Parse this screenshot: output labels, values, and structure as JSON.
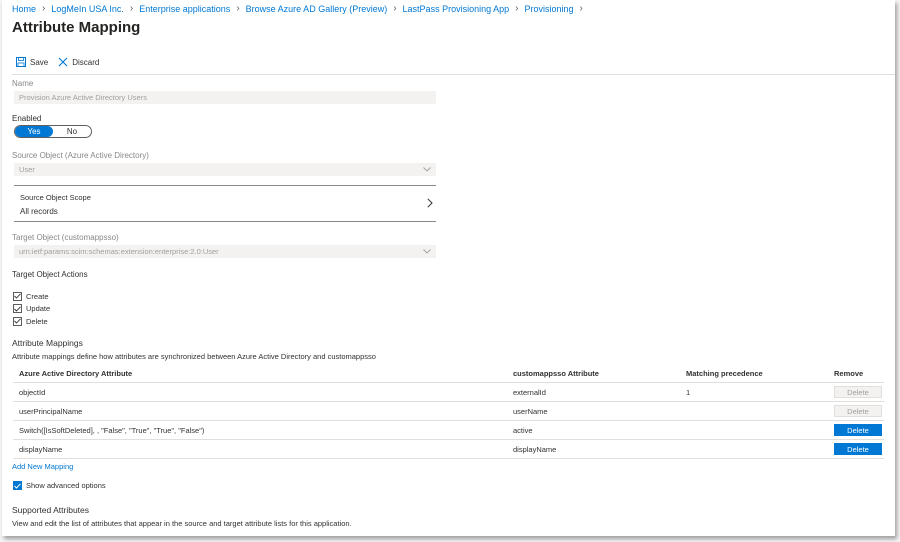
{
  "breadcrumb": [
    {
      "label": "Home"
    },
    {
      "label": "LogMeIn USA Inc."
    },
    {
      "label": "Enterprise applications"
    },
    {
      "label": "Browse Azure AD Gallery (Preview)"
    },
    {
      "label": "LastPass Provisioning App"
    },
    {
      "label": "Provisioning"
    }
  ],
  "page_title": "Attribute Mapping",
  "toolbar": {
    "save_label": "Save",
    "discard_label": "Discard"
  },
  "form": {
    "name_label": "Name",
    "name_value": "Provision Azure Active Directory Users",
    "enabled_label": "Enabled",
    "enabled_yes": "Yes",
    "enabled_no": "No",
    "source_object_label": "Source Object (Azure Active Directory)",
    "source_object_value": "User",
    "source_scope_label": "Source Object Scope",
    "source_scope_value": "All records",
    "target_object_label": "Target Object (customappsso)",
    "target_object_value": "urn:ietf:params:scim:schemas:extension:enterprise:2.0:User",
    "target_actions_label": "Target Object Actions",
    "target_actions": [
      {
        "label": "Create",
        "checked": true
      },
      {
        "label": "Update",
        "checked": true
      },
      {
        "label": "Delete",
        "checked": true
      }
    ]
  },
  "mappings": {
    "heading": "Attribute Mappings",
    "description": "Attribute mappings define how attributes are synchronized between Azure Active Directory and customappsso",
    "columns": [
      "Azure Active Directory Attribute",
      "customappsso Attribute",
      "Matching precedence",
      "Remove"
    ],
    "rows": [
      {
        "source": "objectId",
        "target": "externalId",
        "precedence": "1",
        "delete": "Delete",
        "delete_enabled": false
      },
      {
        "source": "userPrincipalName",
        "target": "userName",
        "precedence": "",
        "delete": "Delete",
        "delete_enabled": false
      },
      {
        "source": "Switch([IsSoftDeleted], , \"False\", \"True\", \"True\", \"False\")",
        "target": "active",
        "precedence": "",
        "delete": "Delete",
        "delete_enabled": true
      },
      {
        "source": "displayName",
        "target": "displayName",
        "precedence": "",
        "delete": "Delete",
        "delete_enabled": true
      }
    ],
    "add_new_label": "Add New Mapping",
    "show_advanced_label": "Show advanced options"
  },
  "supported": {
    "heading": "Supported Attributes",
    "description": "View and edit the list of attributes that appear in the source and target attribute lists for this application."
  },
  "colors": {
    "accent": "#0078d4",
    "disabled_bg": "#f3f2f1"
  }
}
